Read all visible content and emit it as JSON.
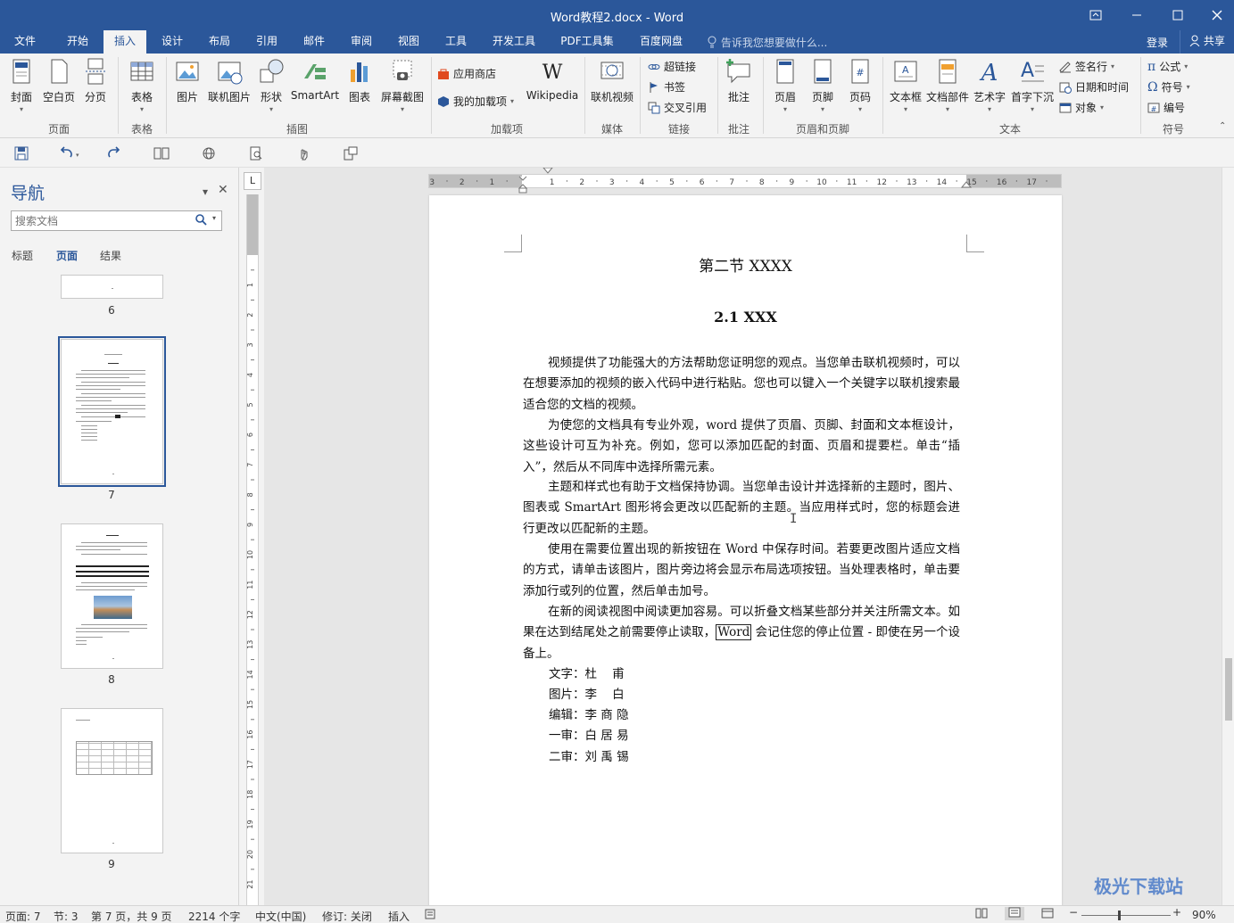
{
  "window": {
    "title": "Word教程2.docx - Word",
    "controls": [
      "restore-ribbon",
      "minimize",
      "maximize",
      "close"
    ]
  },
  "tabs": [
    {
      "label": "文件"
    },
    {
      "label": "开始"
    },
    {
      "label": "插入",
      "active": true
    },
    {
      "label": "设计"
    },
    {
      "label": "布局"
    },
    {
      "label": "引用"
    },
    {
      "label": "邮件"
    },
    {
      "label": "审阅"
    },
    {
      "label": "视图"
    },
    {
      "label": "工具"
    },
    {
      "label": "开发工具"
    },
    {
      "label": "PDF工具集"
    },
    {
      "label": "百度网盘"
    }
  ],
  "tell_me": "告诉我您想要做什么...",
  "login": "登录",
  "share": "共享",
  "ribbon": {
    "pages": {
      "group": "页面",
      "cover": "封面",
      "blank": "空白页",
      "break": "分页"
    },
    "tables": {
      "group": "表格",
      "table": "表格"
    },
    "illustrations": {
      "group": "插图",
      "picture": "图片",
      "online_picture": "联机图片",
      "shapes": "形状",
      "smartart": "SmartArt",
      "chart": "图表",
      "screenshot": "屏幕截图"
    },
    "addins": {
      "group": "加载项",
      "store": "应用商店",
      "my_addins": "我的加载项",
      "wikipedia": "Wikipedia"
    },
    "media": {
      "group": "媒体",
      "online_video": "联机视频"
    },
    "links": {
      "group": "链接",
      "hyperlink": "超链接",
      "bookmark": "书签",
      "cross_ref": "交叉引用"
    },
    "comments": {
      "group": "批注",
      "comment": "批注"
    },
    "header_footer": {
      "group": "页眉和页脚",
      "header": "页眉",
      "footer": "页脚",
      "page_number": "页码"
    },
    "text": {
      "group": "文本",
      "textbox": "文本框",
      "quick_parts": "文档部件",
      "wordart": "艺术字",
      "dropcap": "首字下沉",
      "signature": "签名行",
      "datetime": "日期和时间",
      "object": "对象"
    },
    "symbols": {
      "group": "符号",
      "equation": "公式",
      "symbol": "符号",
      "numbering": "编号"
    }
  },
  "qat": [
    "save-icon",
    "undo-icon",
    "redo-icon",
    "read-mode-icon",
    "web-icon",
    "print-preview-icon",
    "touch-icon",
    "customize-icon"
  ],
  "nav": {
    "title": "导航",
    "search_placeholder": "搜索文档",
    "tabs": [
      {
        "label": "标题"
      },
      {
        "label": "页面",
        "active": true
      },
      {
        "label": "结果"
      }
    ],
    "pages": [
      "6",
      "7",
      "8",
      "9"
    ]
  },
  "ruler_marks": [
    "3",
    "2",
    "1",
    "1",
    "2",
    "3",
    "4",
    "5",
    "6",
    "7",
    "8",
    "9",
    "10",
    "11",
    "12",
    "13",
    "14",
    "15",
    "16",
    "17"
  ],
  "vruler_marks": [
    "1",
    "2",
    "3",
    "4",
    "5",
    "6",
    "7",
    "8",
    "9",
    "10",
    "11",
    "12",
    "13",
    "14",
    "15",
    "16",
    "17",
    "18",
    "19",
    "20",
    "21"
  ],
  "document": {
    "heading1": "第二节  XXXX",
    "heading2": "2.1 XXX",
    "paragraphs": [
      "视频提供了功能强大的方法帮助您证明您的观点。当您单击联机视频时，可以在想要添加的视频的嵌入代码中进行粘贴。您也可以键入一个关键字以联机搜索最适合您的文档的视频。",
      "为使您的文档具有专业外观，word 提供了页眉、页脚、封面和文本框设计，这些设计可互为补充。例如，您可以添加匹配的封面、页眉和提要栏。单击“插入”，然后从不同库中选择所需元素。",
      "主题和样式也有助于文档保持协调。当您单击设计并选择新的主题时，图片、图表或 SmartArt 图形将会更改以匹配新的主题。当应用样式时，您的标题会进行更改以匹配新的主题。",
      "使用在需要位置出现的新按钮在 Word 中保存时间。若要更改图片适应文档的方式，请单击该图片，图片旁边将会显示布局选项按钮。当处理表格时，单击要添加行或列的位置，然后单击加号。"
    ],
    "para5_before": "在新的阅读视图中阅读更加容易。可以折叠文档某些部分并关注所需文本。如果在达到结尾处之前需要停止读取，",
    "para5_boxed": "Word",
    "para5_after": " 会记住您的停止位置 - 即使在另一个设备上。",
    "credits": [
      {
        "role": "文字：",
        "name": "杜    甫"
      },
      {
        "role": "图片：",
        "name": "李    白"
      },
      {
        "role": "编辑：",
        "name": "李 商 隐"
      },
      {
        "role": "一审：",
        "name": "白 居 易"
      },
      {
        "role": "二审：",
        "name": "刘 禹 锡"
      }
    ]
  },
  "status": {
    "page": "页面: 7",
    "section": "节: 3",
    "page_of": "第 7 页，共 9 页",
    "words": "2214 个字",
    "language": "中文(中国)",
    "track": "修订: 关闭",
    "mode": "插入",
    "zoom": "90%"
  },
  "watermark": "极光下载站",
  "colors": {
    "accent": "#2b579a"
  }
}
